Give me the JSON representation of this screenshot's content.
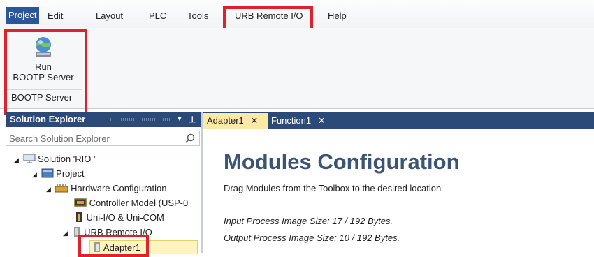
{
  "menu": {
    "items": [
      "Project",
      "Edit",
      "Layout",
      "PLC",
      "Tools",
      "URB Remote I/O",
      "Help"
    ]
  },
  "ribbon": {
    "run_button_label_line1": "Run",
    "run_button_label_line2": "BOOTP Server",
    "group_label": "BOOTP Server",
    "run_icon": "globe-server-icon"
  },
  "solution_explorer": {
    "title": "Solution Explorer",
    "search_placeholder": "Search Solution Explorer",
    "tree": [
      {
        "label": "Solution 'RIO '",
        "icon": "solution-icon"
      },
      {
        "label": "Project",
        "icon": "project-icon"
      },
      {
        "label": "Hardware Configuration",
        "icon": "hardware-icon"
      },
      {
        "label": "Controller Model (USP-0",
        "icon": "controller-icon"
      },
      {
        "label": "Uni-I/O & Uni-COM",
        "icon": "module-icon"
      },
      {
        "label": "URB Remote I/O",
        "icon": "urb-icon"
      },
      {
        "label": "Adapter1",
        "icon": "adapter-icon"
      }
    ]
  },
  "tabs": [
    {
      "label": "Adapter1"
    },
    {
      "label": "Function1"
    }
  ],
  "document": {
    "title": "Modules Configuration",
    "subtitle": "Drag Modules from the Toolbox to the desired location",
    "input_size": "Input Process Image Size: 17 / 192 Bytes.",
    "output_size": "Output Process Image Size: 10 / 192 Bytes."
  },
  "colors": {
    "accent": "#2b579a",
    "panel_header": "#2c4a78",
    "highlight_red": "#e0202a",
    "doc_title": "#3a5476"
  }
}
